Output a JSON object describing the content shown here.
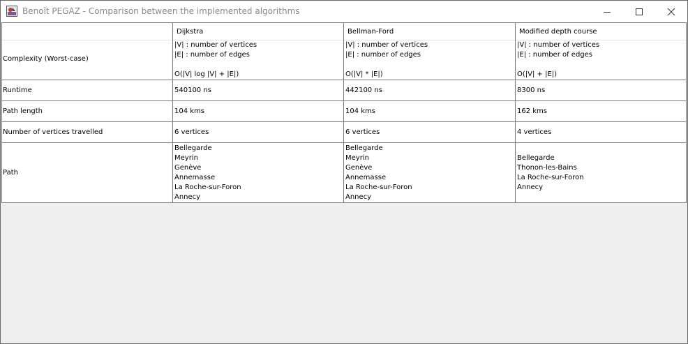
{
  "window": {
    "title": "Benoît PEGAZ - Comparison between the implemented algorithms"
  },
  "table": {
    "headers": [
      "",
      "Dijkstra",
      "Bellman-Ford",
      "Modified depth course"
    ],
    "rows": [
      {
        "label": "Complexity (Worst-case)",
        "cells": [
          [
            "|V| : number of vertices",
            "|E| : number of edges",
            "",
            "O(|V| log |V| + |E|)"
          ],
          [
            "|V| : number of vertices",
            "|E| : number of edges",
            "",
            "O(|V| * |E|)"
          ],
          [
            "|V| : number of vertices",
            "|E| : number of edges",
            "",
            "O(|V| + |E|)"
          ]
        ]
      },
      {
        "label": "Runtime",
        "cells": [
          "540100 ns",
          "442100 ns",
          "8300 ns"
        ]
      },
      {
        "label": "Path length",
        "cells": [
          "104 kms",
          "104 kms",
          "162 kms"
        ]
      },
      {
        "label": "Number of vertices travelled",
        "cells": [
          "6 vertices",
          "6 vertices",
          "4 vertices"
        ]
      },
      {
        "label": "Path",
        "cells": [
          [
            "Bellegarde",
            "Meyrin",
            "Genève",
            "Annemasse",
            "La Roche-sur-Foron",
            "Annecy"
          ],
          [
            "Bellegarde",
            "Meyrin",
            "Genève",
            "Annemasse",
            "La Roche-sur-Foron",
            "Annecy"
          ],
          [
            "Bellegarde",
            "Thonon-les-Bains",
            "La Roche-sur-Foron",
            "Annecy"
          ]
        ]
      }
    ]
  }
}
